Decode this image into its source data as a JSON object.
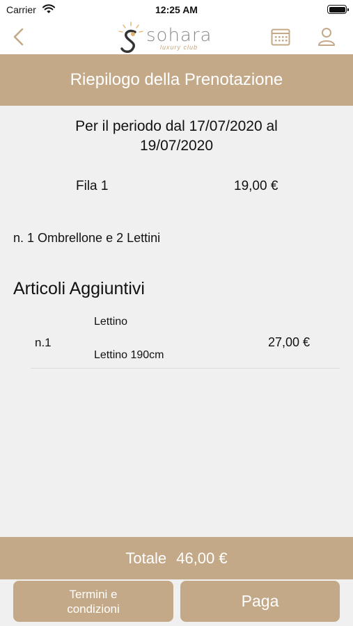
{
  "status_bar": {
    "carrier": "Carrier",
    "time": "12:25 AM"
  },
  "navbar": {
    "logo_word": "sohara",
    "logo_sub": "luxury club"
  },
  "header": {
    "title": "Riepilogo della Prenotazione"
  },
  "booking": {
    "period_line1": "Per il periodo dal 17/07/2020 al",
    "period_line2": "19/07/2020",
    "row_label": "Fila 1",
    "row_price": "19,00 €",
    "umbrella_desc": "n. 1 Ombrellone e 2 Lettini"
  },
  "extras": {
    "heading": "Articoli Aggiuntivi",
    "items": [
      {
        "qty": "n.1",
        "name": "Lettino",
        "detail": "Lettino 190cm",
        "price": "27,00 €"
      }
    ]
  },
  "total": {
    "label": "Totale",
    "amount": "46,00 €"
  },
  "buttons": {
    "terms_line1": "Termini e",
    "terms_line2": "condizioni",
    "pay": "Paga"
  },
  "colors": {
    "accent": "#c3a987",
    "background": "#f0f0f0"
  }
}
